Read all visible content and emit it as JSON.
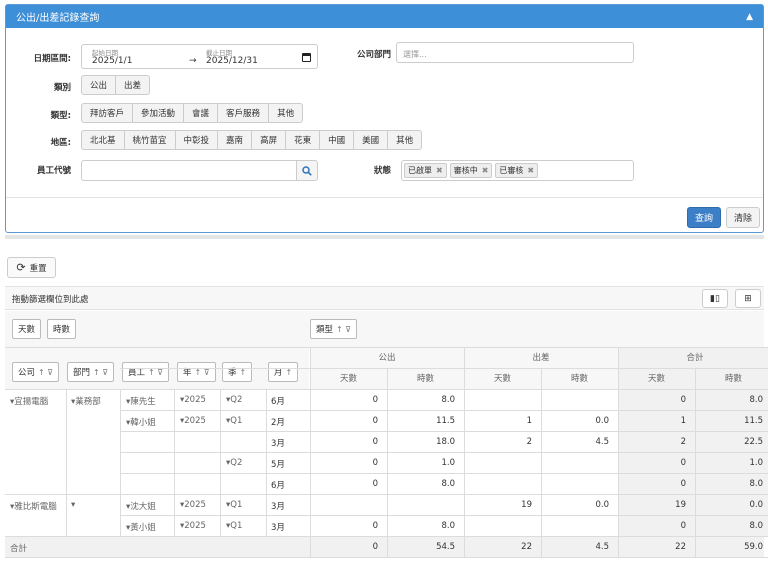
{
  "panel": {
    "title": "公出/出差記錄查詢",
    "collapse_icon": "chevron-up-icon",
    "date_range_label": "日期區間:",
    "start_caption": "起始日期",
    "start_value": "2025/1/1",
    "arrow": "→",
    "end_caption": "截止日期",
    "end_value": "2025/12/31",
    "company_label": "公司部門",
    "company_placeholder": "選擇...",
    "category_label": "類別",
    "categories": [
      "公出",
      "出差"
    ],
    "type_label": "類型:",
    "types": [
      "拜訪客戶",
      "參加活動",
      "會議",
      "客戶服務",
      "其他"
    ],
    "region_label": "地區:",
    "regions": [
      "北北基",
      "桃竹苗宜",
      "中彰投",
      "嘉南",
      "高屏",
      "花東",
      "中國",
      "美國",
      "其他"
    ],
    "employee_label": "員工代號",
    "employee_value": "",
    "status_label": "狀態",
    "status_tags": [
      "已啟單",
      "審核中",
      "已審核"
    ],
    "query_button": "查詢",
    "clear_button": "清除"
  },
  "pivot": {
    "reset_button": "重置",
    "drag_hint": "拖動篩選欄位到此處",
    "value_fields": [
      "天數",
      "時數"
    ],
    "column_field": "類型",
    "row_fields": [
      "公司",
      "部門",
      "員工",
      "年",
      "季",
      "月"
    ],
    "col_groups": [
      "公出",
      "出差",
      "合計"
    ],
    "measures": [
      "天數",
      "時數",
      "天數",
      "時數",
      "天數",
      "時數"
    ],
    "rows": [
      {
        "company": "▾宜揚電腦",
        "dept": "▾業務部",
        "emp": "▾陳先生",
        "year": "▾2025",
        "quarter": "▾Q2",
        "month": "6月",
        "v": [
          "0",
          "8.0",
          "",
          "",
          "0",
          "8.0"
        ]
      },
      {
        "company": "",
        "dept": "",
        "emp": "▾韓小姐",
        "year": "▾2025",
        "quarter": "▾Q1",
        "month": "2月",
        "v": [
          "0",
          "11.5",
          "1",
          "0.0",
          "1",
          "11.5"
        ]
      },
      {
        "company": "",
        "dept": "",
        "emp": "",
        "year": "",
        "quarter": "",
        "month": "3月",
        "v": [
          "0",
          "18.0",
          "2",
          "4.5",
          "2",
          "22.5"
        ]
      },
      {
        "company": "",
        "dept": "",
        "emp": "",
        "year": "",
        "quarter": "▾Q2",
        "month": "5月",
        "v": [
          "0",
          "1.0",
          "",
          "",
          "0",
          "1.0"
        ]
      },
      {
        "company": "",
        "dept": "",
        "emp": "",
        "year": "",
        "quarter": "",
        "month": "6月",
        "v": [
          "0",
          "8.0",
          "",
          "",
          "0",
          "8.0"
        ]
      },
      {
        "company": "▾雅比斯電腦",
        "dept": "▾",
        "emp": "▾沈大姐",
        "year": "▾2025",
        "quarter": "▾Q1",
        "month": "3月",
        "v": [
          "",
          "",
          "19",
          "0.0",
          "19",
          "0.0"
        ]
      },
      {
        "company": "",
        "dept": "",
        "emp": "▾黃小姐",
        "year": "▾2025",
        "quarter": "▾Q1",
        "month": "3月",
        "v": [
          "0",
          "8.0",
          "",
          "",
          "0",
          "8.0"
        ]
      }
    ],
    "total_label": "合計",
    "totals": [
      "0",
      "54.5",
      "22",
      "4.5",
      "22",
      "59.0"
    ]
  }
}
